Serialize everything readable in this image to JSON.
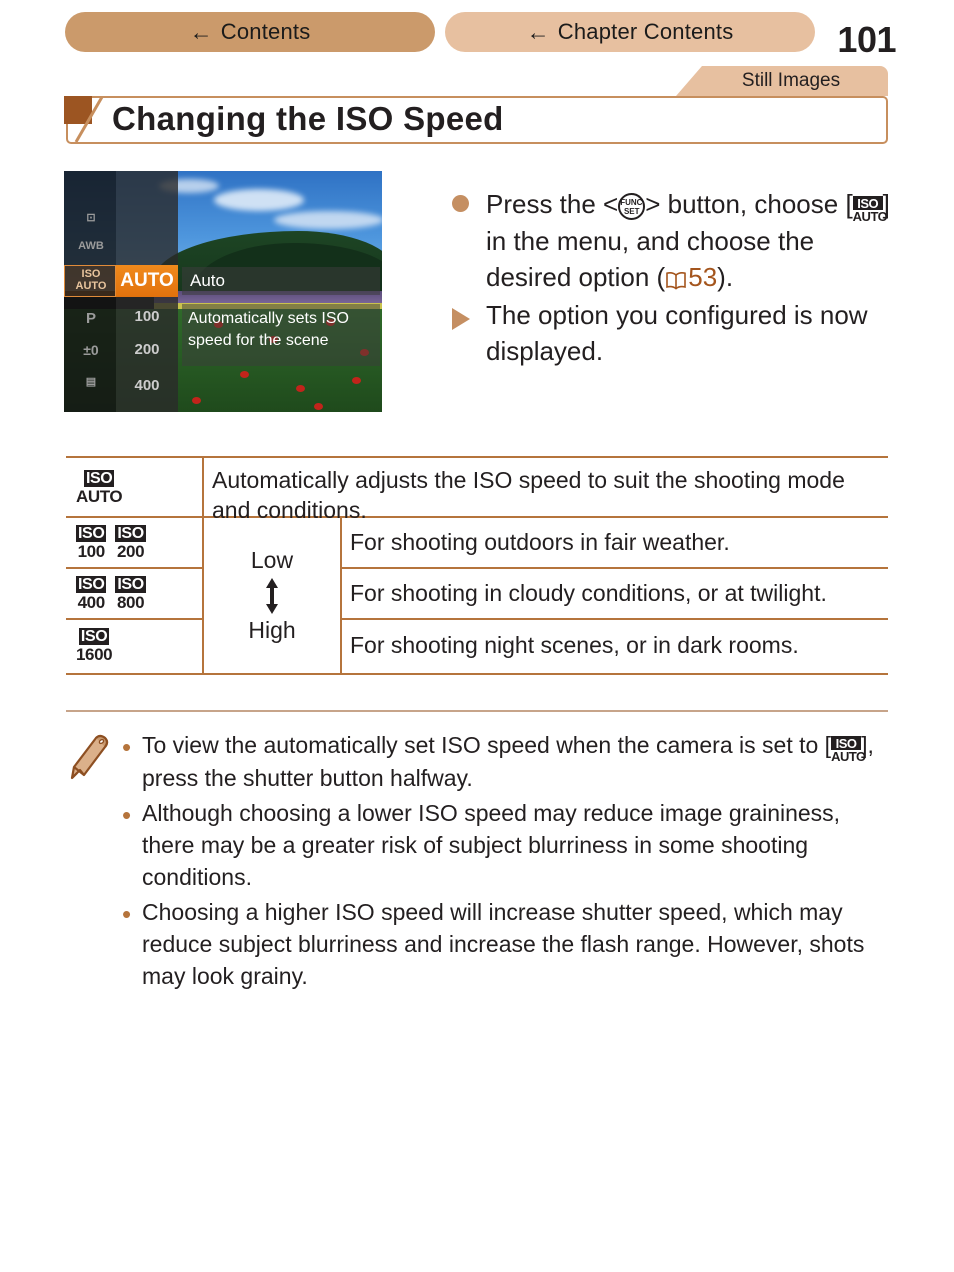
{
  "nav": {
    "back_arrow": "←",
    "contents_label": "Contents",
    "chapter_contents_label": "Chapter Contents",
    "page_number": "101"
  },
  "tab": {
    "still_images_label": "Still Images"
  },
  "section": {
    "title": "Changing the ISO Speed"
  },
  "camera_screen": {
    "left_items": [
      "AWB"
    ],
    "selected_value": "AUTO",
    "numbers": [
      "100",
      "200",
      "400"
    ],
    "option_label": "Auto",
    "option_description": "Automatically sets ISO speed for the scene"
  },
  "instructions": [
    {
      "marker": "bullet",
      "pre": "Press the <",
      "button_icon_top": "FUNC.",
      "button_icon_bottom": "SET",
      "mid": "> button, choose [",
      "iso_icon_top": "ISO",
      "iso_icon_bottom": "AUTO",
      "post": "] in the menu, and choose the desired option (",
      "ref_page": "53",
      "tail": ")."
    },
    {
      "marker": "triangle",
      "text": "The option you configured is now displayed."
    }
  ],
  "table": {
    "rows": [
      {
        "icons": [
          {
            "top": "ISO",
            "bottom": "AUTO"
          }
        ],
        "description": "Automatically adjusts the ISO speed to suit the shooting mode and conditions."
      },
      {
        "icons": [
          {
            "top": "ISO",
            "bottom": "100"
          },
          {
            "top": "ISO",
            "bottom": "200"
          }
        ],
        "description": "For shooting outdoors in fair weather."
      },
      {
        "icons": [
          {
            "top": "ISO",
            "bottom": "400"
          },
          {
            "top": "ISO",
            "bottom": "800"
          }
        ],
        "description": "For shooting in cloudy conditions, or at twilight."
      },
      {
        "icons": [
          {
            "top": "ISO",
            "bottom": "1600"
          }
        ],
        "description": "For shooting night scenes, or in dark rooms."
      }
    ],
    "scale": {
      "low_label": "Low",
      "high_label": "High"
    }
  },
  "notes": {
    "bullet_char": "•",
    "items": [
      {
        "pre": "To view the automatically set ISO speed when the camera is set to [",
        "iso_icon_top": "ISO",
        "iso_icon_bottom": "AUTO",
        "post": "], press the shutter button halfway."
      },
      {
        "text": "Although choosing a lower ISO speed may reduce image graininess, there may be a greater risk of subject blurriness in some shooting conditions."
      },
      {
        "text": "Choosing a higher ISO speed will increase shutter speed, which may reduce subject blurriness and increase the flash range. However, shots may look grainy."
      }
    ]
  },
  "colors": {
    "nav_primary": "#cb9a6b",
    "nav_secondary": "#e7c0a0",
    "rule": "#b5743c",
    "accent_brown": "#a4551d",
    "marker": "#c58f62",
    "highlight_orange": "#e2720d"
  }
}
